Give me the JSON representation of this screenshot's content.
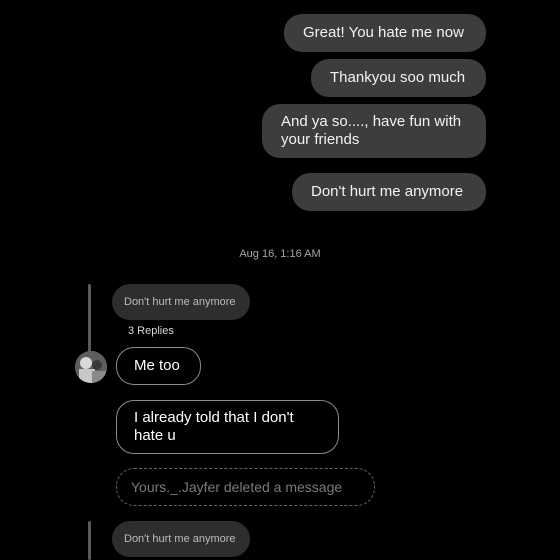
{
  "outgoing": [
    {
      "text": "Great! You hate me now"
    },
    {
      "text": "Thankyou soo much"
    },
    {
      "text": "And ya so...., have fun with your friends"
    },
    {
      "text": "Don't hurt me anymore"
    }
  ],
  "timestamp": "Aug 16, 1:16 AM",
  "thread": {
    "quoted_text": "Don't hurt me anymore",
    "replies_count_label": "3 Replies",
    "replies": [
      {
        "text": "Me too"
      },
      {
        "text": "I already told that I don't hate u"
      }
    ],
    "deleted_notice": "Yours._.Jayfer deleted a message"
  },
  "thread2": {
    "quoted_text": "Don't hurt me anymore"
  },
  "colors": {
    "background": "#000000",
    "outgoing_bubble": "#3d3d3c",
    "quote_bubble": "#2e2e2e",
    "incoming_border": "#8a8a8a"
  }
}
